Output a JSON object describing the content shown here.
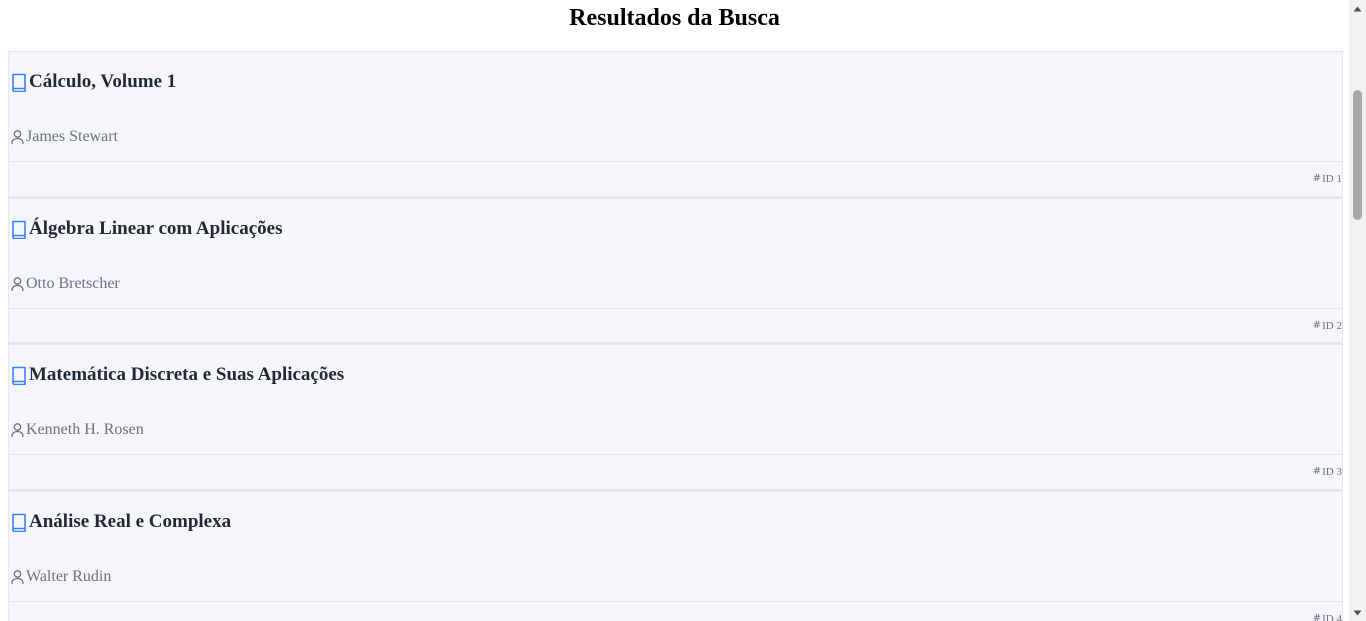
{
  "page": {
    "title": "Resultados da Busca"
  },
  "results": [
    {
      "title": "Cálculo, Volume 1",
      "author": "James Stewart",
      "id_label": "ID 1",
      "icon": "book-icon",
      "author_icon": "user-icon",
      "id_icon": "hash-icon"
    },
    {
      "title": "Álgebra Linear com Aplicações",
      "author": "Otto Bretscher",
      "id_label": "ID 2",
      "icon": "book-icon",
      "author_icon": "user-icon",
      "id_icon": "hash-icon"
    },
    {
      "title": "Matemática Discreta e Suas Aplicações",
      "author": "Kenneth H. Rosen",
      "id_label": "ID 3",
      "icon": "book-icon",
      "author_icon": "user-icon",
      "id_icon": "hash-icon"
    },
    {
      "title": "Análise Real e Complexa",
      "author": "Walter Rudin",
      "id_label": "ID 4",
      "icon": "book-icon",
      "author_icon": "user-icon",
      "id_icon": "hash-icon"
    }
  ],
  "colors": {
    "accent_icon": "#3b82f6",
    "title_text": "#1f2a37",
    "muted_text": "#6b7280",
    "card_bg": "#f5f6fa"
  },
  "scrollbar": {
    "up_icon": "scroll-up-arrow-icon",
    "down_icon": "scroll-down-arrow-icon"
  }
}
